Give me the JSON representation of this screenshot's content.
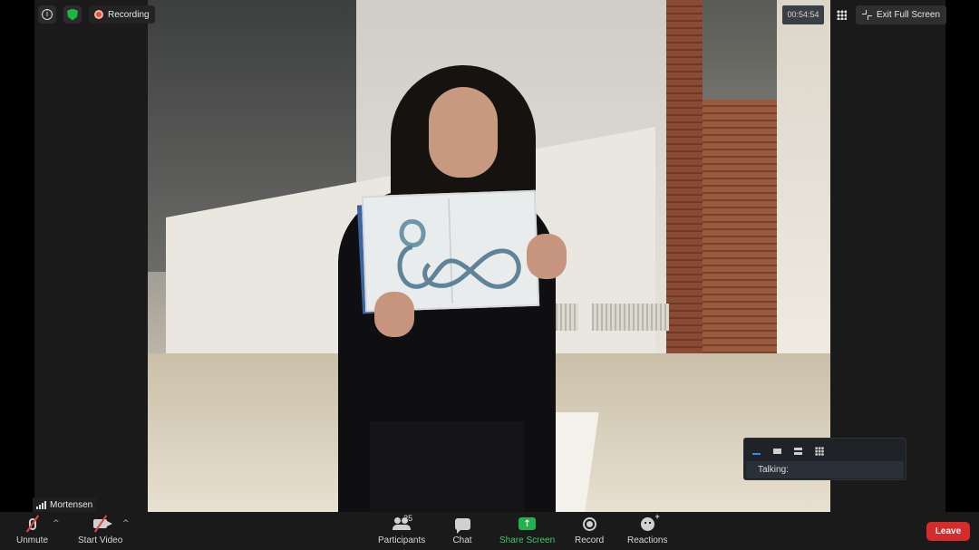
{
  "meeting": {
    "recording_label": "Recording",
    "timer": "00:54:54",
    "exit_fullscreen_label": "Exit Full Screen",
    "participant_name": "Mortensen"
  },
  "talking_panel": {
    "label": "Talking:"
  },
  "toolbar": {
    "unmute_label": "Unmute",
    "start_video_label": "Start Video",
    "participants_label": "Participants",
    "participants_count": "25",
    "chat_label": "Chat",
    "share_screen_label": "Share Screen",
    "record_label": "Record",
    "reactions_label": "Reactions",
    "leave_label": "Leave"
  },
  "colors": {
    "share_green": "#23b14d",
    "leave_red": "#d52b2b",
    "active_blue": "#2d8cff",
    "recording_dot": "#e0533a"
  },
  "icons": [
    "info-icon",
    "shield-icon",
    "recording-icon",
    "grid-icon",
    "exit-fullscreen-icon",
    "signal-icon",
    "mic-muted-icon",
    "video-off-icon",
    "participants-icon",
    "chat-icon",
    "share-screen-icon",
    "record-icon",
    "reactions-icon"
  ]
}
